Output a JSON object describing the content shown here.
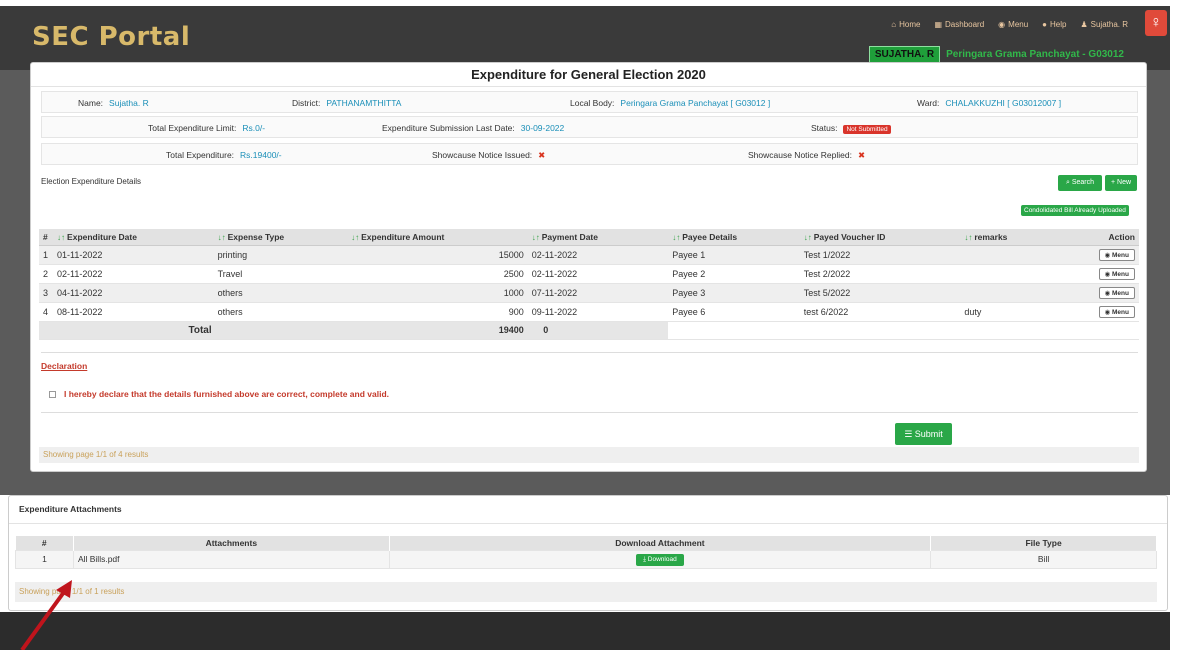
{
  "header": {
    "brand": "SEC Portal",
    "nav": {
      "home": "Home",
      "dashboard": "Dashboard",
      "menu": "Menu",
      "help": "Help",
      "user": "Sujatha. R"
    },
    "user_badge": "SUJATHA. R",
    "user_body": "Peringara Grama Panchayat - G03012"
  },
  "card": {
    "title": "Expenditure for General Election 2020",
    "name_label": "Name:",
    "name": "Sujatha. R",
    "district_label": "District:",
    "district": "PATHANAMTHITTA",
    "local_body_label": "Local Body:",
    "local_body": "Peringara Grama Panchayat [ G03012 ]",
    "ward_label": "Ward:",
    "ward": "CHALAKKUZHI [ G03012007 ]",
    "limit_label": "Total Expenditure Limit:",
    "limit": "Rs.0/-",
    "last_date_label": "Expenditure Submission Last Date:",
    "last_date": "30-09-2022",
    "status_label": "Status:",
    "status": "Not Submitted",
    "total_exp_label": "Total Expenditure:",
    "total_exp": "Rs.19400/-",
    "notice_issued_label": "Showcause Notice Issued:",
    "notice_replied_label": "Showcause Notice Replied:",
    "x_mark": "✖"
  },
  "details": {
    "label": "Election Expenditure Details",
    "search": "Search",
    "new": "New",
    "consolidated": "Condolidated Bill Already Uploaded"
  },
  "table": {
    "headers": {
      "hash": "#",
      "date": "Expenditure Date",
      "type": "Expense Type",
      "amount": "Expenditure Amount",
      "payment": "Payment Date",
      "payee": "Payee Details",
      "voucher": "Payed Voucher ID",
      "remarks": "remarks",
      "action": "Action"
    },
    "rows": [
      {
        "n": "1",
        "date": "01-11-2022",
        "type": "printing",
        "amount": "15000",
        "payment": "02-11-2022",
        "payee": "Payee 1",
        "voucher": "Test 1/2022",
        "remarks": "",
        "action": "Menu"
      },
      {
        "n": "2",
        "date": "02-11-2022",
        "type": "Travel",
        "amount": "2500",
        "payment": "02-11-2022",
        "payee": "Payee 2",
        "voucher": "Test 2/2022",
        "remarks": "",
        "action": "Menu"
      },
      {
        "n": "3",
        "date": "04-11-2022",
        "type": "others",
        "amount": "1000",
        "payment": "07-11-2022",
        "payee": "Payee 3",
        "voucher": "Test 5/2022",
        "remarks": "",
        "action": "Menu"
      },
      {
        "n": "4",
        "date": "08-11-2022",
        "type": "others",
        "amount": "900",
        "payment": "09-11-2022",
        "payee": "Payee 6",
        "voucher": "test 6/2022",
        "remarks": "duty",
        "action": "Menu"
      }
    ],
    "total_label": "Total",
    "total_amount": "19400",
    "total_payment": "0"
  },
  "declaration": {
    "title": "Declaration",
    "text": "I hereby declare that the details furnished above are correct, complete and valid."
  },
  "submit": "Submit",
  "showing": "Showing page 1/1 of 4 results",
  "attachments": {
    "title": "Expenditure Attachments",
    "headers": {
      "hash": "#",
      "name": "Attachments",
      "download": "Download Attachment",
      "filetype": "File Type"
    },
    "rows": [
      {
        "n": "1",
        "name": "All Bills.pdf",
        "download": "Download",
        "filetype": "Bill"
      }
    ],
    "showing": "Showing page 1/1 of 1 results"
  },
  "colors": {
    "accent": "#2aa748",
    "danger": "#d9342b",
    "link": "#1a8fb8",
    "arrow": "#c0141c"
  }
}
